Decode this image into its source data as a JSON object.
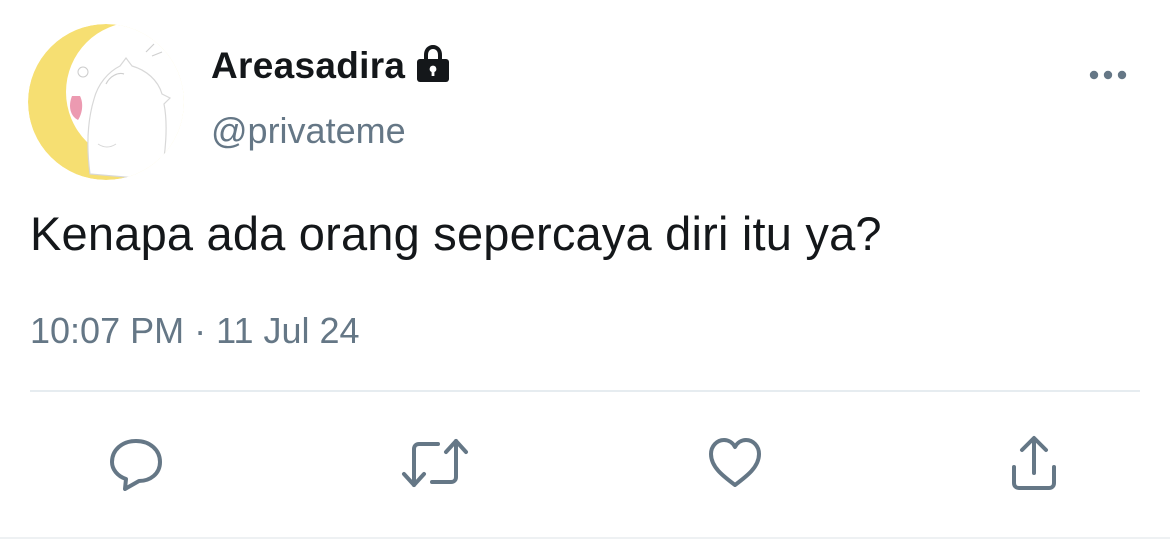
{
  "tweet": {
    "display_name": "Areasadira",
    "handle": "@privateme",
    "text": "Kenapa ada orang sepercaya diri itu ya?",
    "time": "10:07 PM",
    "separator": "·",
    "date": "11 Jul 24",
    "protected": true
  },
  "icons": {
    "protected": "lock-icon",
    "more": "more-dots-icon",
    "reply": "reply-icon",
    "retweet": "retweet-icon",
    "like": "heart-icon",
    "share": "share-icon"
  },
  "colors": {
    "text": "#14171a",
    "secondary": "#657786",
    "divider": "#e6ecf0",
    "avatar_bg": "#f6df72"
  }
}
